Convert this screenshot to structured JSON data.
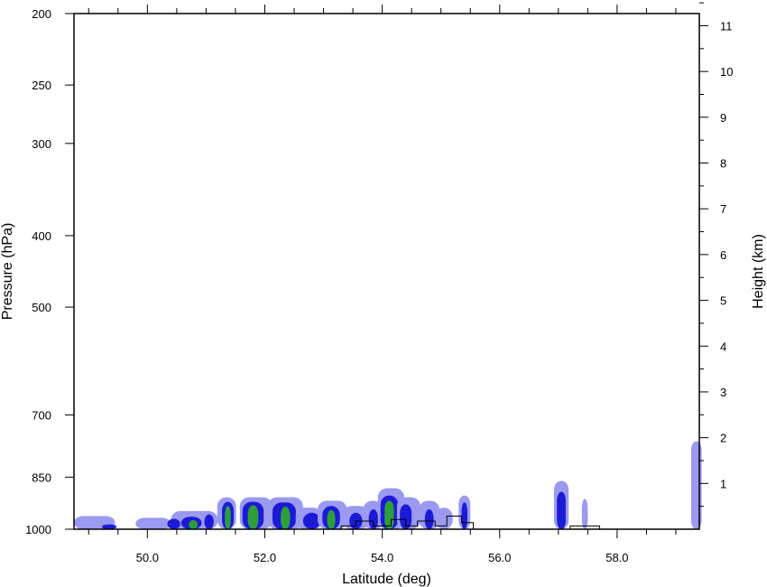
{
  "chart_data": {
    "type": "heatmap",
    "title": "",
    "xlabel": "Latitude (deg)",
    "ylabel_left": "Pressure (hPa)",
    "ylabel_right": "Height (km)",
    "xlim": [
      48.75,
      59.4
    ],
    "x_ticks": [
      {
        "value": 50.0,
        "label": "50.0"
      },
      {
        "value": 52.0,
        "label": "52.0"
      },
      {
        "value": 54.0,
        "label": "54.0"
      },
      {
        "value": 56.0,
        "label": "56.0"
      },
      {
        "value": 58.0,
        "label": "58.0"
      }
    ],
    "pressure_scale": "log",
    "pressure_range": [
      200,
      1000
    ],
    "pressure_ticks": [
      {
        "value": 200,
        "label": "200"
      },
      {
        "value": 250,
        "label": "250"
      },
      {
        "value": 300,
        "label": "300"
      },
      {
        "value": 400,
        "label": "400"
      },
      {
        "value": 500,
        "label": "500"
      },
      {
        "value": 700,
        "label": "700"
      },
      {
        "value": 850,
        "label": "850"
      },
      {
        "value": 1000,
        "label": "1000"
      }
    ],
    "height_ticks": [
      {
        "value": 1,
        "label": "1"
      },
      {
        "value": 2,
        "label": "2"
      },
      {
        "value": 3,
        "label": "3"
      },
      {
        "value": 4,
        "label": "4"
      },
      {
        "value": 5,
        "label": "5"
      },
      {
        "value": 6,
        "label": "6"
      },
      {
        "value": 7,
        "label": "7"
      },
      {
        "value": 8,
        "label": "8"
      },
      {
        "value": 9,
        "label": "9"
      },
      {
        "value": 10,
        "label": "10"
      },
      {
        "value": 11,
        "label": "11"
      }
    ],
    "grid": false,
    "colors": {
      "level_low": "#9a9af0",
      "level_mid": "#1b1bd6",
      "level_high": "#2e9e3a"
    },
    "cells": [
      {
        "lat": 49.1,
        "p_top": 960,
        "lat_span": 0.7,
        "level": 1
      },
      {
        "lat": 49.35,
        "p_top": 985,
        "lat_span": 0.25,
        "level": 2
      },
      {
        "lat": 50.1,
        "p_top": 965,
        "lat_span": 0.6,
        "level": 1
      },
      {
        "lat": 50.8,
        "p_top": 945,
        "lat_span": 0.8,
        "level": 1
      },
      {
        "lat": 50.75,
        "p_top": 962,
        "lat_span": 0.35,
        "level": 2
      },
      {
        "lat": 50.78,
        "p_top": 972,
        "lat_span": 0.15,
        "level": 3
      },
      {
        "lat": 50.45,
        "p_top": 968,
        "lat_span": 0.22,
        "level": 2
      },
      {
        "lat": 51.05,
        "p_top": 955,
        "lat_span": 0.16,
        "level": 2
      },
      {
        "lat": 51.35,
        "p_top": 905,
        "lat_span": 0.32,
        "level": 1
      },
      {
        "lat": 51.37,
        "p_top": 918,
        "lat_span": 0.2,
        "level": 2
      },
      {
        "lat": 51.37,
        "p_top": 930,
        "lat_span": 0.1,
        "level": 3
      },
      {
        "lat": 51.85,
        "p_top": 905,
        "lat_span": 0.55,
        "level": 1
      },
      {
        "lat": 51.8,
        "p_top": 918,
        "lat_span": 0.36,
        "level": 2
      },
      {
        "lat": 51.8,
        "p_top": 928,
        "lat_span": 0.18,
        "level": 3
      },
      {
        "lat": 52.35,
        "p_top": 905,
        "lat_span": 0.6,
        "level": 1
      },
      {
        "lat": 52.33,
        "p_top": 920,
        "lat_span": 0.4,
        "level": 2
      },
      {
        "lat": 52.35,
        "p_top": 932,
        "lat_span": 0.16,
        "level": 3
      },
      {
        "lat": 52.75,
        "p_top": 935,
        "lat_span": 0.45,
        "level": 1
      },
      {
        "lat": 52.8,
        "p_top": 950,
        "lat_span": 0.3,
        "level": 2
      },
      {
        "lat": 53.15,
        "p_top": 915,
        "lat_span": 0.5,
        "level": 1
      },
      {
        "lat": 53.13,
        "p_top": 930,
        "lat_span": 0.3,
        "level": 2
      },
      {
        "lat": 53.13,
        "p_top": 942,
        "lat_span": 0.14,
        "level": 3
      },
      {
        "lat": 53.55,
        "p_top": 930,
        "lat_span": 0.45,
        "level": 1
      },
      {
        "lat": 53.55,
        "p_top": 950,
        "lat_span": 0.22,
        "level": 2
      },
      {
        "lat": 53.85,
        "p_top": 915,
        "lat_span": 0.35,
        "level": 1
      },
      {
        "lat": 53.85,
        "p_top": 940,
        "lat_span": 0.16,
        "level": 2
      },
      {
        "lat": 54.15,
        "p_top": 880,
        "lat_span": 0.45,
        "level": 1
      },
      {
        "lat": 54.12,
        "p_top": 900,
        "lat_span": 0.3,
        "level": 2
      },
      {
        "lat": 54.12,
        "p_top": 915,
        "lat_span": 0.16,
        "level": 3
      },
      {
        "lat": 54.45,
        "p_top": 905,
        "lat_span": 0.4,
        "level": 1
      },
      {
        "lat": 54.4,
        "p_top": 925,
        "lat_span": 0.2,
        "level": 2
      },
      {
        "lat": 54.8,
        "p_top": 915,
        "lat_span": 0.35,
        "level": 1
      },
      {
        "lat": 54.8,
        "p_top": 940,
        "lat_span": 0.15,
        "level": 2
      },
      {
        "lat": 55.05,
        "p_top": 935,
        "lat_span": 0.3,
        "level": 1
      },
      {
        "lat": 55.4,
        "p_top": 900,
        "lat_span": 0.2,
        "level": 1
      },
      {
        "lat": 55.4,
        "p_top": 920,
        "lat_span": 0.1,
        "level": 2
      },
      {
        "lat": 57.05,
        "p_top": 860,
        "lat_span": 0.25,
        "level": 1
      },
      {
        "lat": 57.05,
        "p_top": 890,
        "lat_span": 0.15,
        "level": 2
      },
      {
        "lat": 57.45,
        "p_top": 910,
        "lat_span": 0.1,
        "level": 1
      },
      {
        "lat": 59.35,
        "p_top": 760,
        "lat_span": 0.18,
        "level": 1
      }
    ],
    "terrain_outline": [
      {
        "lat": 53.3,
        "p": 1000
      },
      {
        "lat": 53.3,
        "p": 990
      },
      {
        "lat": 53.55,
        "p": 990
      },
      {
        "lat": 53.55,
        "p": 975
      },
      {
        "lat": 53.85,
        "p": 975
      },
      {
        "lat": 53.85,
        "p": 990
      },
      {
        "lat": 54.15,
        "p": 990
      },
      {
        "lat": 54.15,
        "p": 970
      },
      {
        "lat": 54.4,
        "p": 970
      },
      {
        "lat": 54.4,
        "p": 990
      },
      {
        "lat": 54.6,
        "p": 990
      },
      {
        "lat": 54.6,
        "p": 975
      },
      {
        "lat": 54.9,
        "p": 975
      },
      {
        "lat": 54.9,
        "p": 990
      },
      {
        "lat": 55.1,
        "p": 990
      },
      {
        "lat": 55.1,
        "p": 960
      },
      {
        "lat": 55.35,
        "p": 960
      },
      {
        "lat": 55.35,
        "p": 980
      },
      {
        "lat": 55.55,
        "p": 980
      },
      {
        "lat": 55.55,
        "p": 1000
      }
    ],
    "terrain_outline_2": [
      {
        "lat": 57.2,
        "p": 1000
      },
      {
        "lat": 57.2,
        "p": 990
      },
      {
        "lat": 57.7,
        "p": 990
      },
      {
        "lat": 57.7,
        "p": 1000
      }
    ]
  }
}
